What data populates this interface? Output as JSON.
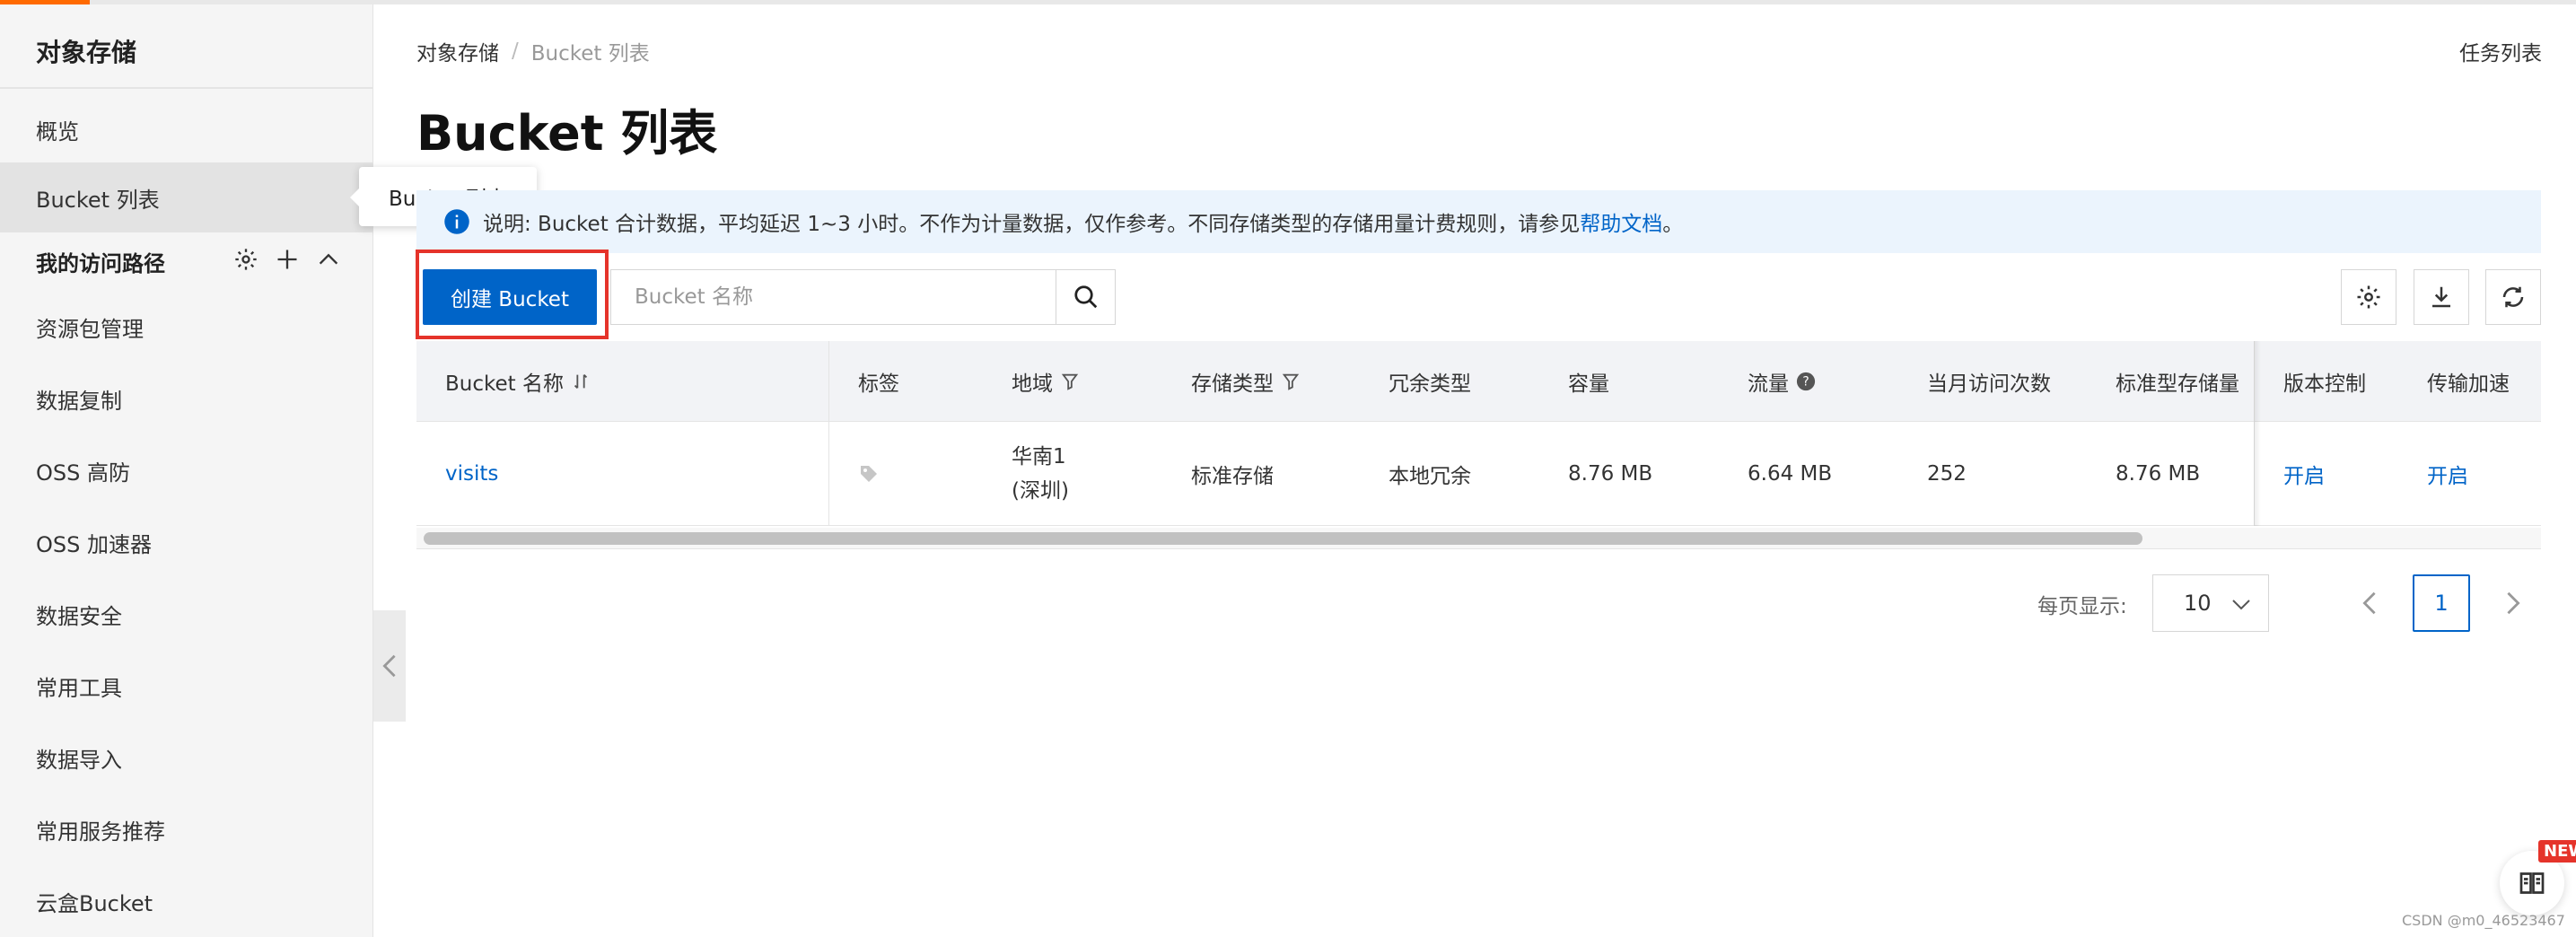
{
  "sidebar": {
    "title": "对象存储",
    "items": [
      {
        "label": "概览"
      },
      {
        "label": "Bucket 列表"
      },
      {
        "label": "我的访问路径"
      },
      {
        "label": "资源包管理"
      },
      {
        "label": "数据复制"
      },
      {
        "label": "OSS 高防"
      },
      {
        "label": "OSS 加速器"
      },
      {
        "label": "数据安全"
      },
      {
        "label": "常用工具"
      },
      {
        "label": "数据导入"
      },
      {
        "label": "常用服务推荐"
      },
      {
        "label": "云盒Bucket"
      }
    ],
    "tooltip": "Bucket 列表"
  },
  "breadcrumb": {
    "root": "对象存储",
    "sep": "/",
    "current": "Bucket 列表"
  },
  "header": {
    "task_list": "任务列表",
    "title": "Bucket 列表"
  },
  "notice": {
    "text": "说明: Bucket 合计数据，平均延迟 1~3 小时。不作为计量数据，仅作参考。不同存储类型的存储用量计费规则，请参见",
    "link": "帮助文档",
    "end": "。"
  },
  "toolbar": {
    "create_label": "创建 Bucket",
    "search_placeholder": "Bucket 名称"
  },
  "table": {
    "headers": [
      "Bucket 名称",
      "标签",
      "地域",
      "存储类型",
      "冗余类型",
      "容量",
      "流量",
      "当月访问次数",
      "标准型存储量",
      "版本控制",
      "传输加速"
    ],
    "rows": [
      {
        "name": "visits",
        "region_line1": "华南1",
        "region_line2": "(深圳)",
        "storage_type": "标准存储",
        "redundancy": "本地冗余",
        "capacity": "8.76 MB",
        "traffic": "6.64 MB",
        "monthly_visits": "252",
        "standard_storage": "8.76 MB",
        "versioning": "开启",
        "acceleration": "开启"
      }
    ]
  },
  "pagination": {
    "per_page_label": "每页显示:",
    "per_page_value": "10",
    "current_page": "1"
  },
  "float": {
    "badge": "NEW"
  },
  "watermark": "CSDN @m0_46523467",
  "colors": {
    "accent": "#0064c8",
    "highlight": "#e5332a",
    "brand": "#ff6a00"
  }
}
